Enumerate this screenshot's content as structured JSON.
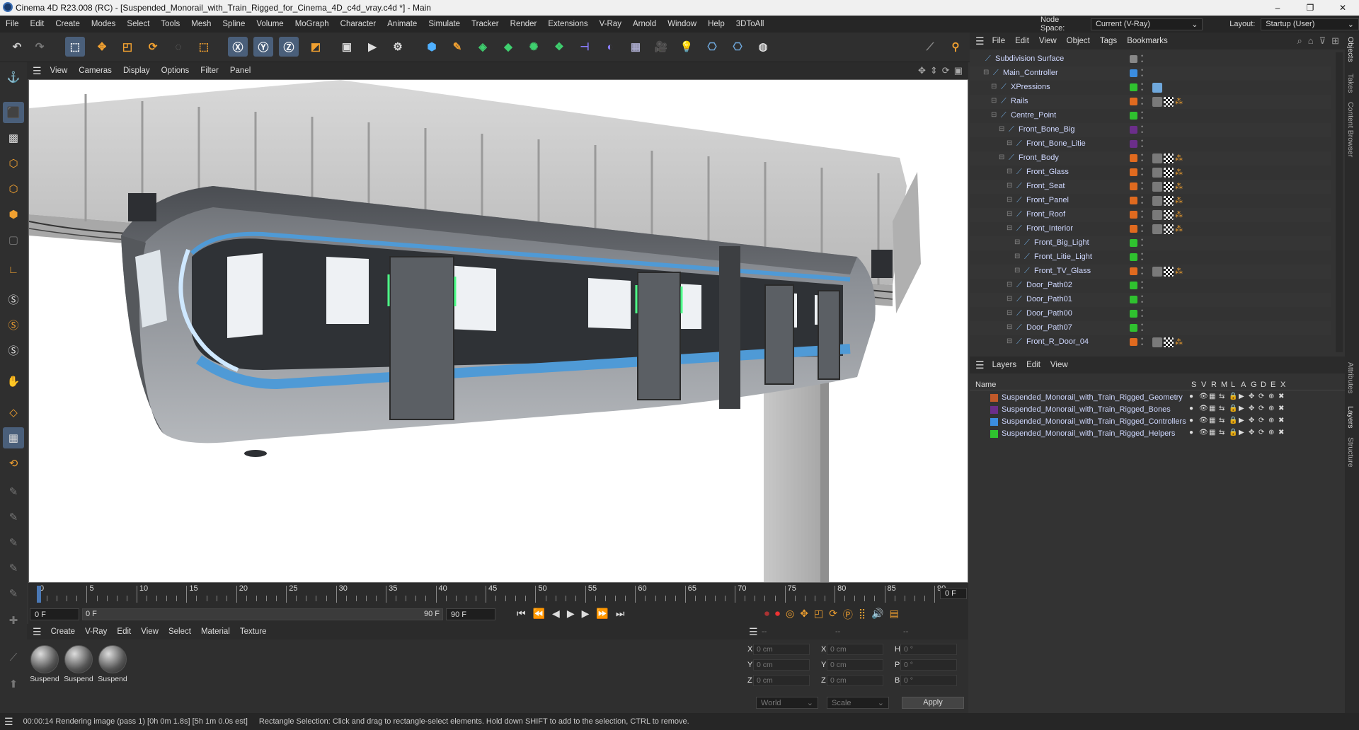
{
  "window": {
    "title": "Cinema 4D R23.008 (RC) - [Suspended_Monorail_with_Train_Rigged_for_Cinema_4D_c4d_vray.c4d *] - Main",
    "controls": [
      "–",
      "❐",
      "✕"
    ]
  },
  "menu": [
    "File",
    "Edit",
    "Create",
    "Modes",
    "Select",
    "Tools",
    "Mesh",
    "Spline",
    "Volume",
    "MoGraph",
    "Character",
    "Animate",
    "Simulate",
    "Tracker",
    "Render",
    "Extensions",
    "V-Ray",
    "Arnold",
    "Window",
    "Help",
    "3DToAll"
  ],
  "node_space": {
    "label": "Node Space:",
    "value": "Current (V-Ray)"
  },
  "layout": {
    "label": "Layout:",
    "value": "Startup (User)"
  },
  "viewport_menu": [
    "View",
    "Cameras",
    "Display",
    "Options",
    "Filter",
    "Panel"
  ],
  "object_manager": {
    "menu": [
      "File",
      "Edit",
      "View",
      "Object",
      "Tags",
      "Bookmarks"
    ],
    "objects": [
      {
        "name": "Subdivision Surface",
        "depth": 0,
        "color": "#888888",
        "tags": []
      },
      {
        "name": "Main_Controller",
        "depth": 1,
        "color": "#3b8de0",
        "tags": []
      },
      {
        "name": "XPressions",
        "depth": 2,
        "color": "#2fc12f",
        "tags": [
          "xpresso"
        ]
      },
      {
        "name": "Rails",
        "depth": 2,
        "color": "#e06a1f",
        "tags": [
          "vray",
          "checker",
          "dots"
        ]
      },
      {
        "name": "Centre_Point",
        "depth": 2,
        "color": "#2fc12f",
        "tags": []
      },
      {
        "name": "Front_Bone_Big",
        "depth": 3,
        "color": "#6b2e8a",
        "tags": []
      },
      {
        "name": "Front_Bone_Litie",
        "depth": 4,
        "color": "#6b2e8a",
        "tags": []
      },
      {
        "name": "Front_Body",
        "depth": 3,
        "color": "#e06a1f",
        "tags": [
          "vray",
          "checker",
          "dots"
        ]
      },
      {
        "name": "Front_Glass",
        "depth": 4,
        "color": "#e06a1f",
        "tags": [
          "vray",
          "checker",
          "dots"
        ]
      },
      {
        "name": "Front_Seat",
        "depth": 4,
        "color": "#e06a1f",
        "tags": [
          "vray",
          "checker",
          "dots"
        ]
      },
      {
        "name": "Front_Panel",
        "depth": 4,
        "color": "#e06a1f",
        "tags": [
          "vray",
          "checker",
          "dots"
        ]
      },
      {
        "name": "Front_Roof",
        "depth": 4,
        "color": "#e06a1f",
        "tags": [
          "vray",
          "checker",
          "dots"
        ]
      },
      {
        "name": "Front_Interior",
        "depth": 4,
        "color": "#e06a1f",
        "tags": [
          "vray",
          "checker",
          "dots"
        ]
      },
      {
        "name": "Front_Big_Light",
        "depth": 5,
        "color": "#2fc12f",
        "tags": []
      },
      {
        "name": "Front_Litie_Light",
        "depth": 5,
        "color": "#2fc12f",
        "tags": []
      },
      {
        "name": "Front_TV_Glass",
        "depth": 5,
        "color": "#e06a1f",
        "tags": [
          "vray",
          "checker",
          "dots"
        ]
      },
      {
        "name": "Door_Path02",
        "depth": 4,
        "color": "#2fc12f",
        "tags": []
      },
      {
        "name": "Door_Path01",
        "depth": 4,
        "color": "#2fc12f",
        "tags": []
      },
      {
        "name": "Door_Path00",
        "depth": 4,
        "color": "#2fc12f",
        "tags": []
      },
      {
        "name": "Door_Path07",
        "depth": 4,
        "color": "#2fc12f",
        "tags": []
      },
      {
        "name": "Front_R_Door_04",
        "depth": 4,
        "color": "#e06a1f",
        "tags": [
          "vray",
          "checker",
          "dots"
        ]
      }
    ]
  },
  "layer_manager": {
    "menu": [
      "Layers",
      "Edit",
      "View"
    ],
    "header_name": "Name",
    "header_flags": [
      "S",
      "V",
      "R",
      "M",
      "L",
      "A",
      "G",
      "D",
      "E",
      "X"
    ],
    "layers": [
      {
        "name": "Suspended_Monorail_with_Train_Rigged_Geometry",
        "color": "#c0592a"
      },
      {
        "name": "Suspended_Monorail_with_Train_Rigged_Bones",
        "color": "#6b2e8a"
      },
      {
        "name": "Suspended_Monorail_with_Train_Rigged_Controllers",
        "color": "#3b8de0"
      },
      {
        "name": "Suspended_Monorail_with_Train_Rigged_Helpers",
        "color": "#2fc12f"
      }
    ]
  },
  "side_tabs": [
    "Objects",
    "Takes",
    "Content Browser",
    "Attributes",
    "Layers",
    "Structure"
  ],
  "timeline": {
    "ticks": [
      "0",
      "5",
      "10",
      "15",
      "20",
      "25",
      "30",
      "35",
      "40",
      "45",
      "50",
      "55",
      "60",
      "65",
      "70",
      "75",
      "80",
      "85",
      "90"
    ],
    "current_frame": "0 F",
    "start_field": "0 F",
    "range_start": "0 F",
    "range_end": "90 F",
    "end_field": "90 F"
  },
  "material_manager": {
    "menu": [
      "Create",
      "V-Ray",
      "Edit",
      "View",
      "Select",
      "Material",
      "Texture"
    ],
    "materials": [
      "Suspend",
      "Suspend",
      "Suspend"
    ]
  },
  "coordinates": {
    "headers": [
      "--",
      "--",
      "--"
    ],
    "rows": [
      {
        "a": "X",
        "a_val": "0 cm",
        "b": "X",
        "b_val": "0 cm",
        "c": "H",
        "c_val": "0 °"
      },
      {
        "a": "Y",
        "a_val": "0 cm",
        "b": "Y",
        "b_val": "0 cm",
        "c": "P",
        "c_val": "0 °"
      },
      {
        "a": "Z",
        "a_val": "0 cm",
        "b": "Z",
        "b_val": "0 cm",
        "c": "B",
        "c_val": "0 °"
      }
    ],
    "world": "World",
    "scale": "Scale",
    "apply": "Apply"
  },
  "status": {
    "left": "00:00:14 Rendering image (pass 1) [0h  0m  1.8s] [5h  1m  0.0s est]",
    "right": "Rectangle Selection: Click and drag to rectangle-select elements. Hold down SHIFT to add to the selection, CTRL to remove."
  }
}
